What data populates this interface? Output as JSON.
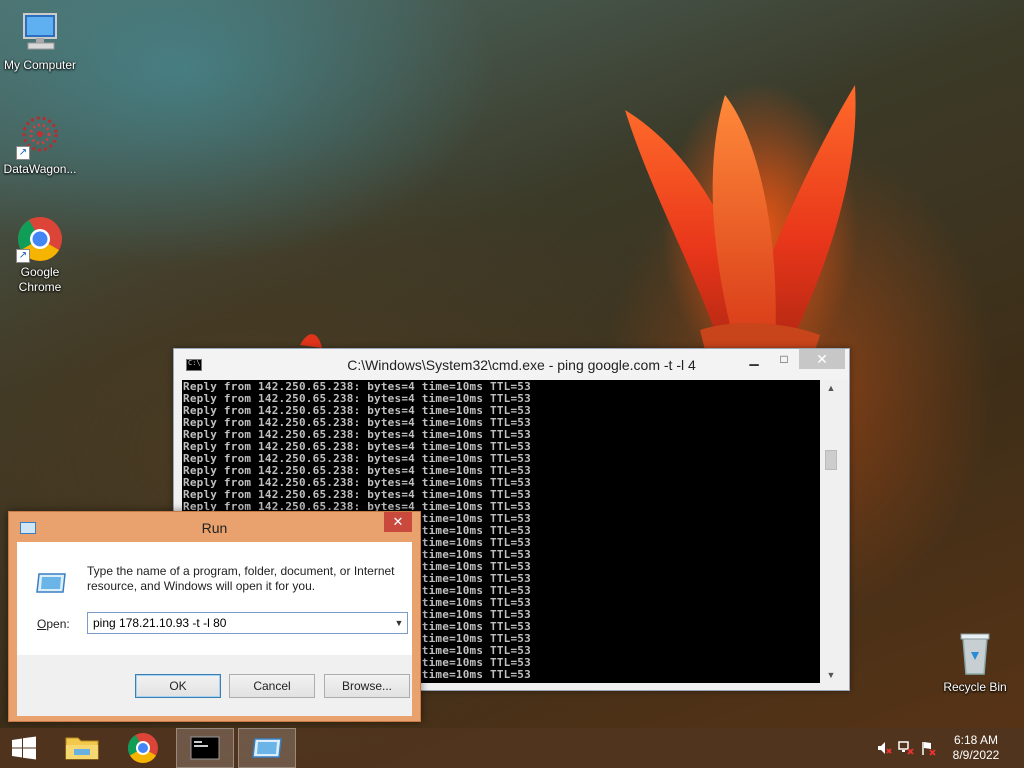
{
  "desktop": {
    "icons": [
      {
        "label": "My Computer"
      },
      {
        "label": "DataWagon..."
      },
      {
        "label_line1": "Google",
        "label_line2": "Chrome"
      },
      {
        "label": "Recycle Bin"
      }
    ]
  },
  "cmd_window": {
    "title": "C:\\Windows\\System32\\cmd.exe - ping  google.com -t -l 4",
    "lines_full": [
      "Reply from 142.250.65.238: bytes=4 time=10ms TTL=53",
      "Reply from 142.250.65.238: bytes=4 time=10ms TTL=53",
      "Reply from 142.250.65.238: bytes=4 time=10ms TTL=53",
      "Reply from 142.250.65.238: bytes=4 time=10ms TTL=53",
      "Reply from 142.250.65.238: bytes=4 time=10ms TTL=53",
      "Reply from 142.250.65.238: bytes=4 time=10ms TTL=53",
      "Reply from 142.250.65.238: bytes=4 time=10ms TTL=53",
      "Reply from 142.250.65.238: bytes=4 time=10ms TTL=53",
      "Reply from 142.250.65.238: bytes=4 time=10ms TTL=53",
      "Reply from 142.250.65.238: bytes=4 time=10ms TTL=53",
      "Reply from 142.250.65.238: bytes=4 time=10ms TTL=53",
      "Reply from 142.250.65.238: bytes=4 time=10ms TTL=53",
      "Reply from 142.250.65.238: bytes=4 time=10ms TTL=53",
      "Reply from 142.250.65.238: bytes=4 time=10ms TTL=53",
      "Reply from 142.250.65.238: bytes=4 time=10ms TTL=53",
      "Reply from 142.250.65.238: bytes=4 time=10ms TTL=53",
      "Reply from 142.250.65.238: bytes=4 time=10ms TTL=53",
      "Reply from 142.250.65.238: bytes=4 time=10ms TTL=53",
      "Reply from 142.250.65.238: bytes=4 time=10ms TTL=53",
      "Reply from 142.250.65.238: bytes=4 time=10ms TTL=53",
      "Reply from 142.250.65.238: bytes=4 time=10ms TTL=53",
      "Reply from 142.250.65.238: bytes=4 time=10ms TTL=53",
      "Reply from 142.250.65.238: bytes=4 time=10ms TTL=53",
      "Reply from 142.250.65.238: bytes=4 time=10ms TTL=53",
      "Reply from 142.250.65.238: bytes=4 time=10ms TTL=53"
    ]
  },
  "run_dialog": {
    "title": "Run",
    "description": "Type the name of a program, folder, document, or Internet resource, and Windows will open it for you.",
    "open_label_prefix": "O",
    "open_label_rest": "pen:",
    "input_value": "ping 178.21.10.93 -t -l 80",
    "ok_label": "OK",
    "cancel_label": "Cancel",
    "browse_label": "Browse..."
  },
  "taskbar": {
    "clock_time": "6:18 AM",
    "clock_date": "8/9/2022"
  },
  "colors": {
    "run_frame": "#e9a26e",
    "run_close": "#c94a3d",
    "taskbar": "#50341e"
  }
}
